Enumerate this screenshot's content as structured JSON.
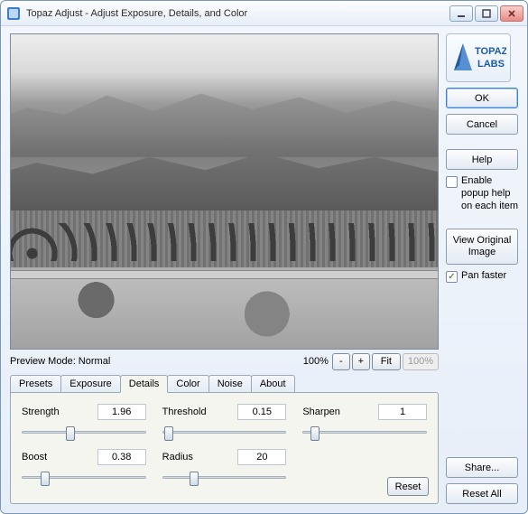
{
  "window": {
    "title": "Topaz Adjust - Adjust Exposure, Details, and Color"
  },
  "logo": {
    "line1": "TOPAZ",
    "line2": "LABS"
  },
  "sidebar": {
    "ok": "OK",
    "cancel": "Cancel",
    "help": "Help",
    "enable_popup": "Enable popup help on each item",
    "enable_popup_checked": false,
    "view_original": "View Original Image",
    "pan_faster": "Pan faster",
    "pan_faster_checked": true,
    "share": "Share...",
    "reset_all": "Reset All"
  },
  "preview": {
    "mode_label": "Preview Mode: Normal",
    "zoom_text": "100%",
    "minus": "-",
    "plus": "+",
    "fit": "Fit",
    "hundred": "100%"
  },
  "tabs": {
    "items": [
      "Presets",
      "Exposure",
      "Details",
      "Color",
      "Noise",
      "About"
    ],
    "active_index": 2
  },
  "details_panel": {
    "strength": {
      "label": "Strength",
      "value": "1.96",
      "pos": 0.39
    },
    "threshold": {
      "label": "Threshold",
      "value": "0.15",
      "pos": 0.05
    },
    "sharpen": {
      "label": "Sharpen",
      "value": "1",
      "pos": 0.1
    },
    "boost": {
      "label": "Boost",
      "value": "0.38",
      "pos": 0.19
    },
    "radius": {
      "label": "Radius",
      "value": "20",
      "pos": 0.26
    },
    "reset": "Reset"
  }
}
